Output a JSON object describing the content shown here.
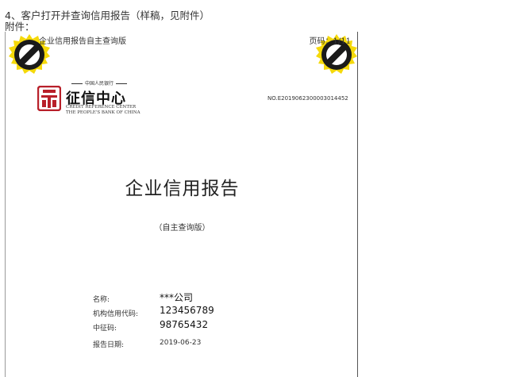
{
  "intro": {
    "line1": "4、客户打开并查询信用报告（样稿，见附件）",
    "line2": "附件："
  },
  "document": {
    "running_header": "企业信用报告自主查询版",
    "page_number": "页码：1/11",
    "logo": {
      "tagline": "中国人民银行",
      "name_cn": "征信中心",
      "name_en_line1": "CREDIT REFERENCE CENTER",
      "name_en_line2": "THE PEOPLE'S BANK OF CHINA"
    },
    "report_number": "NO.E2019062300003014452",
    "title": "企业信用报告",
    "subtitle": "（自主查询版）",
    "fields": [
      {
        "label": "名称:",
        "value": "***公司"
      },
      {
        "label": "机构信用代码:",
        "value": "123456789"
      },
      {
        "label": "中征码:",
        "value": "98765432"
      },
      {
        "label": "报告日期:",
        "value": "2019-06-23"
      }
    ]
  },
  "colors": {
    "logo_red": "#b8202a",
    "seal_yellow": "#f5d90a",
    "seal_dark": "#1a1a1a"
  }
}
